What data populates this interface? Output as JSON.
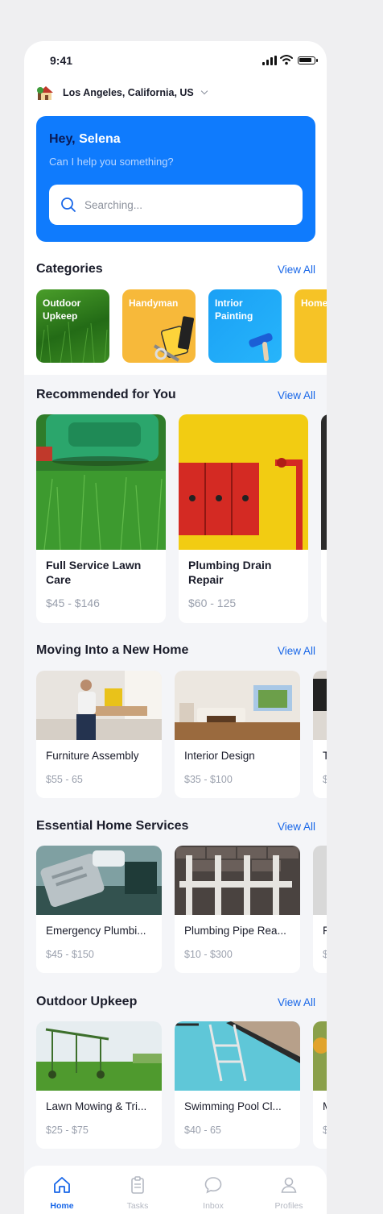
{
  "status_bar": {
    "time": "9:41"
  },
  "location": {
    "text": "Los Angeles, California, US"
  },
  "hero": {
    "greeting": "Hey,",
    "name": "Selena",
    "subtitle": "Can I help you something?"
  },
  "search": {
    "placeholder": "Searching..."
  },
  "categories": {
    "title": "Categories",
    "view_all": "View All",
    "items": [
      {
        "label": "Outdoor Upkeep"
      },
      {
        "label": "Handyman"
      },
      {
        "label": "Intrior Painting"
      },
      {
        "label": "Home Clean"
      }
    ]
  },
  "recommended": {
    "title": "Recommended for You",
    "view_all": "View All",
    "items": [
      {
        "title": "Full Service Lawn Care",
        "price": "$45 - $146"
      },
      {
        "title": "Plumbing Drain Repair",
        "price": "$60 - 125"
      }
    ]
  },
  "moving": {
    "title": "Moving Into a New Home",
    "view_all": "View All",
    "items": [
      {
        "title": "Furniture Assembly",
        "price": "$55 - 65"
      },
      {
        "title": "Interior Design",
        "price": "$35 - $100"
      },
      {
        "title": "T",
        "price": "$"
      }
    ]
  },
  "essential": {
    "title": "Essential Home Services",
    "view_all": "View All",
    "items": [
      {
        "title": "Emergency Plumbi...",
        "price": "$45 - $150"
      },
      {
        "title": "Plumbing Pipe Rea...",
        "price": "$10 - $300"
      },
      {
        "title": "F",
        "price": "$"
      }
    ]
  },
  "outdoor": {
    "title": "Outdoor Upkeep",
    "view_all": "View All",
    "items": [
      {
        "title": "Lawn Mowing & Tri...",
        "price": "$25 - $75"
      },
      {
        "title": "Swimming Pool Cl...",
        "price": "$40 - 65"
      },
      {
        "title": "M",
        "price": "$"
      }
    ]
  },
  "tabbar": {
    "items": [
      {
        "label": "Home",
        "icon": "home-icon",
        "active": true
      },
      {
        "label": "Tasks",
        "icon": "clipboard-icon"
      },
      {
        "label": "Inbox",
        "icon": "chat-bubble-icon"
      },
      {
        "label": "Profiles",
        "icon": "user-icon"
      }
    ]
  },
  "colors": {
    "primary": "#0f7bfd",
    "accent_link": "#1766e8",
    "background": "#f4f5f8"
  }
}
